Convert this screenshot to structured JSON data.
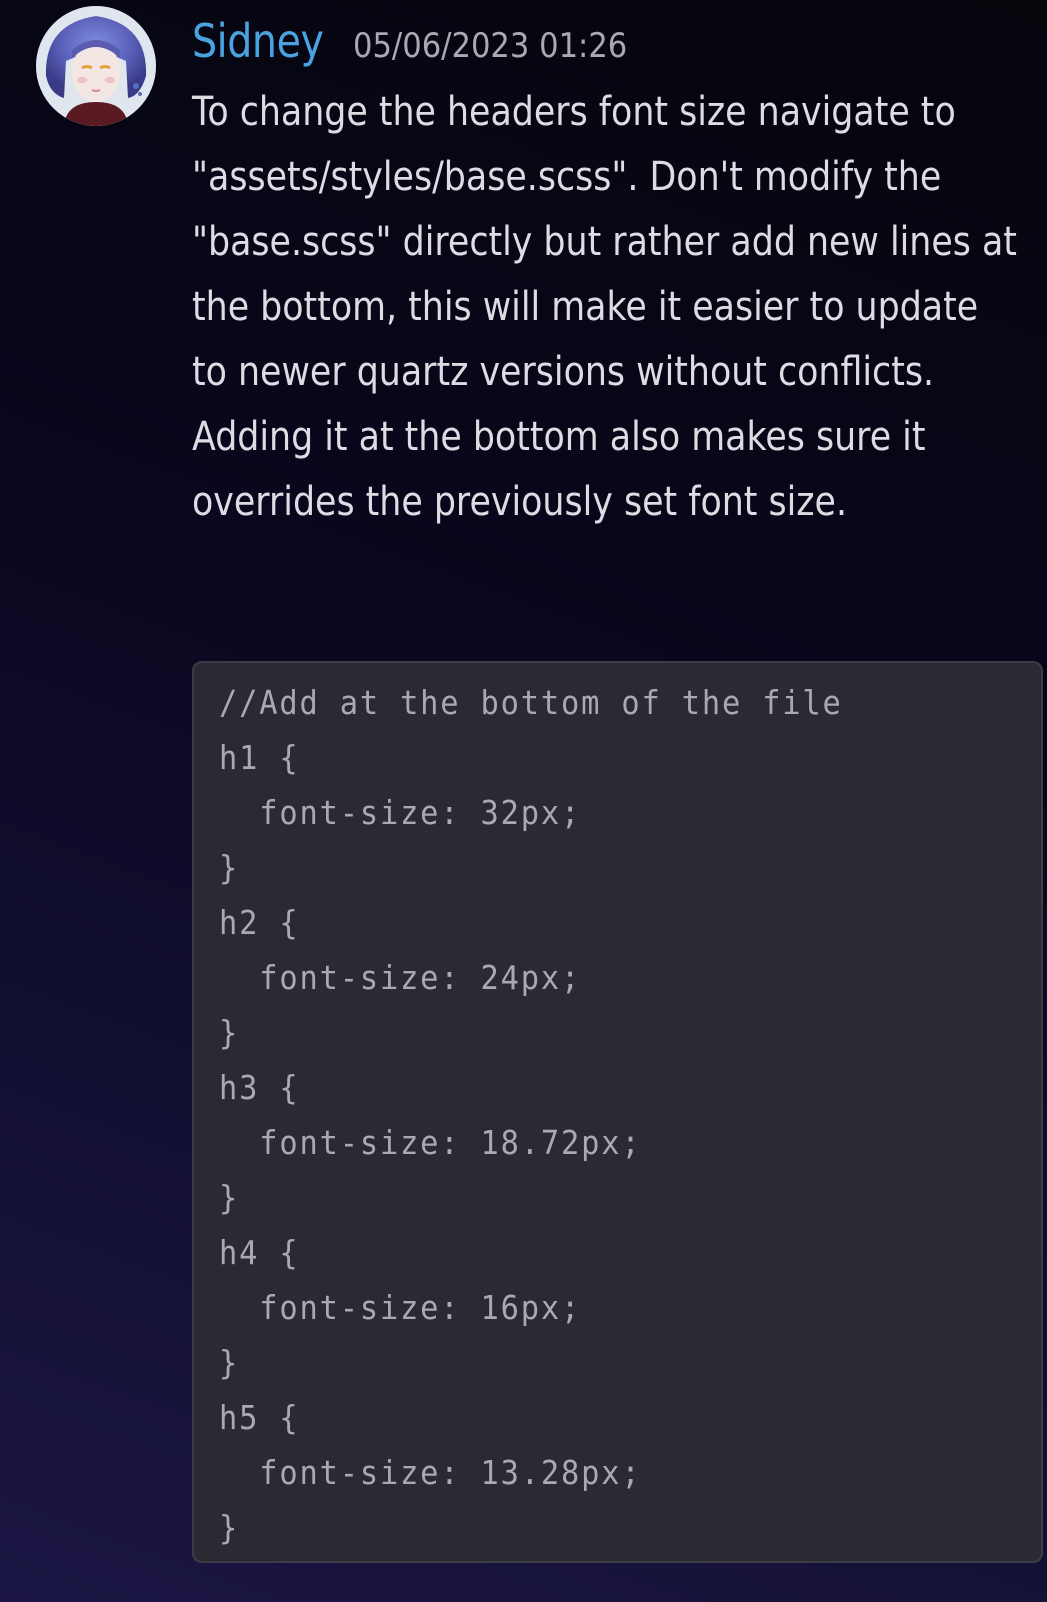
{
  "message": {
    "author": "Sidney",
    "author_color": "#4aa3e0",
    "timestamp": "05/06/2023 01:26",
    "avatar_icon": "user-avatar",
    "text": "To change the headers font size navigate to \"assets/styles/base.scss\". Don't modify the \"base.scss\" directly but rather add new lines at the bottom, this will make it easier to update to newer quartz versions without conflicts. Adding it at the bottom also makes sure it overrides the previously set font size.",
    "code": {
      "lines": [
        "//Add at the bottom of the file",
        "h1 {",
        "  font-size: 32px;",
        "}",
        "h2 {",
        "  font-size: 24px;",
        "}",
        "h3 {",
        "  font-size: 18.72px;",
        "}",
        "h4 {",
        "  font-size: 16px;",
        "}",
        "h5 {",
        "  font-size: 13.28px;",
        "}"
      ]
    }
  }
}
